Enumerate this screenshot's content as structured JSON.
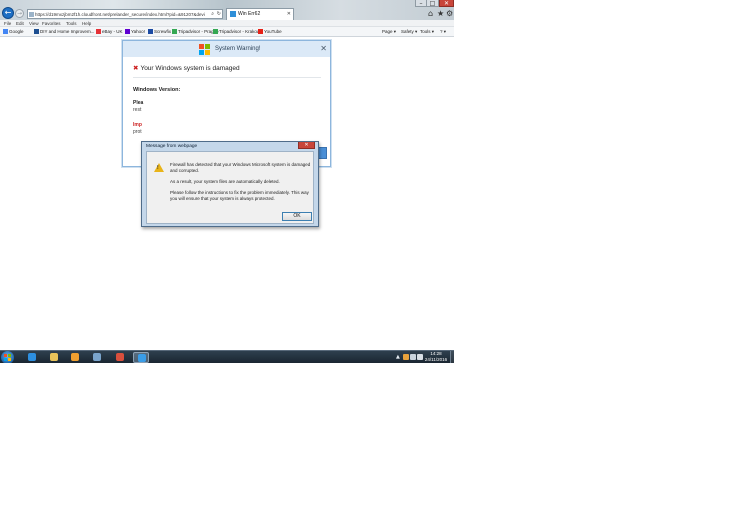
{
  "browser": {
    "address_url": "https://d19mxzjbm2f1h.cloudfront.net/prelander_secure/index.html?pid=&91207&device_",
    "tab_title": "Win Err62",
    "menu": [
      "File",
      "Edit",
      "View",
      "Favorites",
      "Tools",
      "Help"
    ],
    "favorites": [
      {
        "label": "Google",
        "color": "#4285f4"
      },
      {
        "label": "DIY and Home Improvem...",
        "color": "#1d4f91"
      },
      {
        "label": "eBay - UK",
        "color": "#e53238"
      },
      {
        "label": "Yahoo!",
        "color": "#5f01d1"
      },
      {
        "label": "Screwfix",
        "color": "#1b4aa3"
      },
      {
        "label": "Tripadvisor - Prague",
        "color": "#34a853"
      },
      {
        "label": "Tripadvisor - Krakow",
        "color": "#34a853"
      },
      {
        "label": "YouTube",
        "color": "#e62117"
      }
    ],
    "commands": [
      "Page ▾",
      "Safety ▾",
      "Tools ▾",
      "? ▾"
    ],
    "icons": {
      "back": "back-arrow-icon",
      "forward": "forward-arrow-icon",
      "home": "home-icon",
      "favorites": "star-icon",
      "settings": "gear-icon"
    }
  },
  "fake_alert": {
    "title": "System Warning!",
    "heading": "Your Windows system is damaged",
    "version_label": "Windows Version:",
    "line1_visible": "Plea",
    "line1b_visible": "rest",
    "line2_visible": "Imp",
    "line2b_visible": "prot",
    "logo_colors": [
      "#f25022",
      "#7fba00",
      "#00a4ef",
      "#ffb900"
    ]
  },
  "message_box": {
    "title": "Message from webpage",
    "lines": [
      "Firewall has detected that your Windows Microsoft system is damaged",
      "and corrupted.",
      "As a result, your system files are automatically deleted.",
      "Please follow the instructions to fix the problem immediately. This way",
      "you will ensure that your system is always protected."
    ],
    "ok_label": "OK",
    "close_glyph": "✕"
  },
  "taskbar": {
    "apps": [
      {
        "name": "ie",
        "color": "#2d8fe0"
      },
      {
        "name": "explorer",
        "color": "#e8c35a"
      },
      {
        "name": "media-player",
        "color": "#f0a030"
      },
      {
        "name": "paint",
        "color": "#7aa4cc"
      },
      {
        "name": "chrome",
        "color": "#d94f3d"
      },
      {
        "name": "ie-active",
        "color": "#3a9de8"
      }
    ],
    "tray_arrow": "▲",
    "time": "14:28",
    "date": "24/11/2016"
  }
}
